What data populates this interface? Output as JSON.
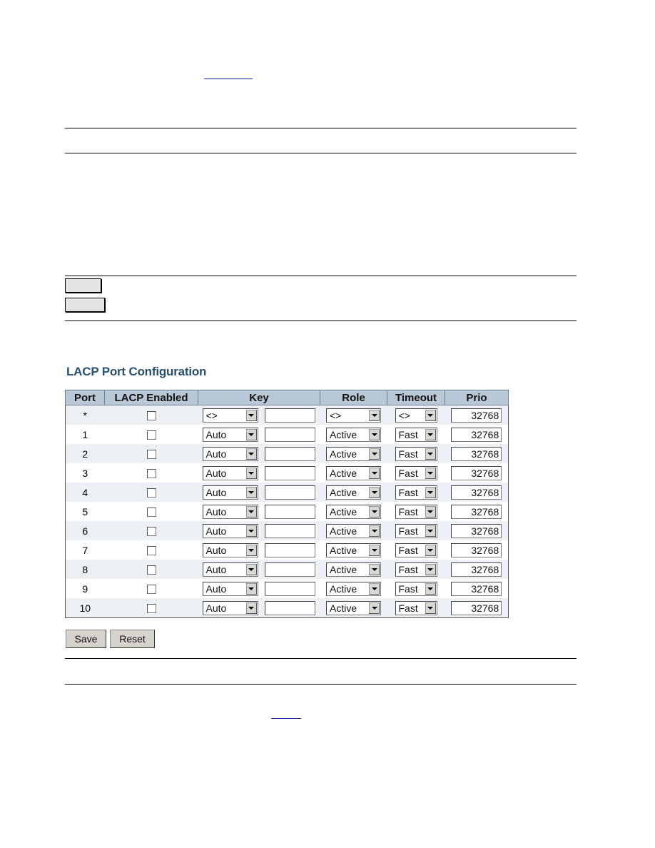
{
  "page": {
    "section_title": "LACP Port Configuration"
  },
  "table": {
    "headers": [
      "Port",
      "LACP Enabled",
      "Key",
      "Role",
      "Timeout",
      "Prio"
    ],
    "rows": [
      {
        "port": "*",
        "enabled": false,
        "key": "<>",
        "key_value": "",
        "role": "<>",
        "timeout": "<>",
        "prio": "32768"
      },
      {
        "port": "1",
        "enabled": false,
        "key": "Auto",
        "key_value": "",
        "role": "Active",
        "timeout": "Fast",
        "prio": "32768"
      },
      {
        "port": "2",
        "enabled": false,
        "key": "Auto",
        "key_value": "",
        "role": "Active",
        "timeout": "Fast",
        "prio": "32768"
      },
      {
        "port": "3",
        "enabled": false,
        "key": "Auto",
        "key_value": "",
        "role": "Active",
        "timeout": "Fast",
        "prio": "32768"
      },
      {
        "port": "4",
        "enabled": false,
        "key": "Auto",
        "key_value": "",
        "role": "Active",
        "timeout": "Fast",
        "prio": "32768"
      },
      {
        "port": "5",
        "enabled": false,
        "key": "Auto",
        "key_value": "",
        "role": "Active",
        "timeout": "Fast",
        "prio": "32768"
      },
      {
        "port": "6",
        "enabled": false,
        "key": "Auto",
        "key_value": "",
        "role": "Active",
        "timeout": "Fast",
        "prio": "32768"
      },
      {
        "port": "7",
        "enabled": false,
        "key": "Auto",
        "key_value": "",
        "role": "Active",
        "timeout": "Fast",
        "prio": "32768"
      },
      {
        "port": "8",
        "enabled": false,
        "key": "Auto",
        "key_value": "",
        "role": "Active",
        "timeout": "Fast",
        "prio": "32768"
      },
      {
        "port": "9",
        "enabled": false,
        "key": "Auto",
        "key_value": "",
        "role": "Active",
        "timeout": "Fast",
        "prio": "32768"
      },
      {
        "port": "10",
        "enabled": false,
        "key": "Auto",
        "key_value": "",
        "role": "Active",
        "timeout": "Fast",
        "prio": "32768"
      }
    ]
  },
  "buttons": {
    "save": "Save",
    "reset": "Reset"
  }
}
